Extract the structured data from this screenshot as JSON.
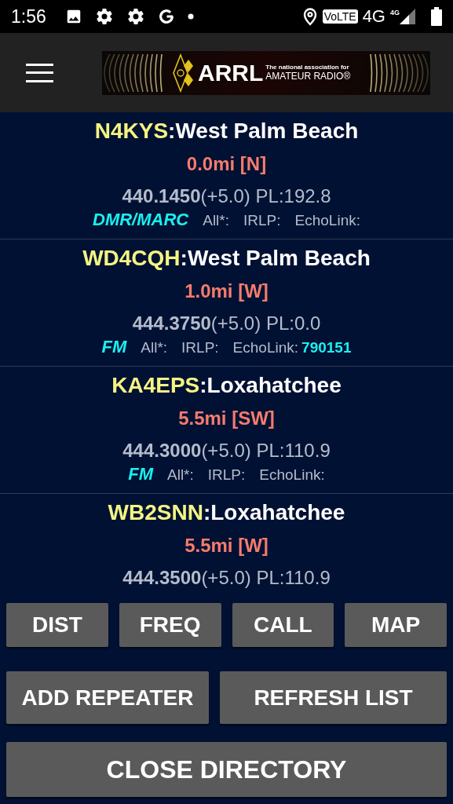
{
  "status_bar": {
    "time": "1:56",
    "volte": "VoLTE",
    "network": "4G",
    "signal_network": "4G"
  },
  "app_bar": {
    "logo": {
      "name": "ARRL",
      "tagline": "The national association for",
      "subtitle": "AMATEUR RADIO®"
    }
  },
  "repeaters": [
    {
      "callsign": "N4KYS",
      "separator": ":",
      "city": "West Palm Beach",
      "distance": "0.0mi [N]",
      "frequency": "440.1450",
      "offset": "(+5.0)",
      "pl": "PL:192.8",
      "mode": "DMR/MARC",
      "all": "All*:",
      "irlp": "IRLP:",
      "echolink": "EchoLink:"
    },
    {
      "callsign": "WD4CQH",
      "separator": ":",
      "city": "West Palm Beach",
      "distance": "1.0mi [W]",
      "frequency": "444.3750",
      "offset": "(+5.0)",
      "pl": "PL:0.0",
      "mode": "FM",
      "all": "All*:",
      "irlp": "IRLP:",
      "echolink": "EchoLink:",
      "echolink_node": "790151"
    },
    {
      "callsign": "KA4EPS",
      "separator": ":",
      "city": "Loxahatchee",
      "distance": "5.5mi [SW]",
      "frequency": "444.3000",
      "offset": "(+5.0)",
      "pl": "PL:110.9",
      "mode": "FM",
      "all": "All*:",
      "irlp": "IRLP:",
      "echolink": "EchoLink:"
    },
    {
      "callsign": "WB2SNN",
      "separator": ":",
      "city": "Loxahatchee",
      "distance": "5.5mi [W]",
      "frequency": "444.3500",
      "offset": "(+5.0)",
      "pl": "PL:110.9"
    }
  ],
  "sort_buttons": [
    "DIST",
    "FREQ",
    "CALL",
    "MAP"
  ],
  "action_buttons": [
    "ADD REPEATER",
    "REFRESH LIST"
  ],
  "close_button": "CLOSE DIRECTORY"
}
